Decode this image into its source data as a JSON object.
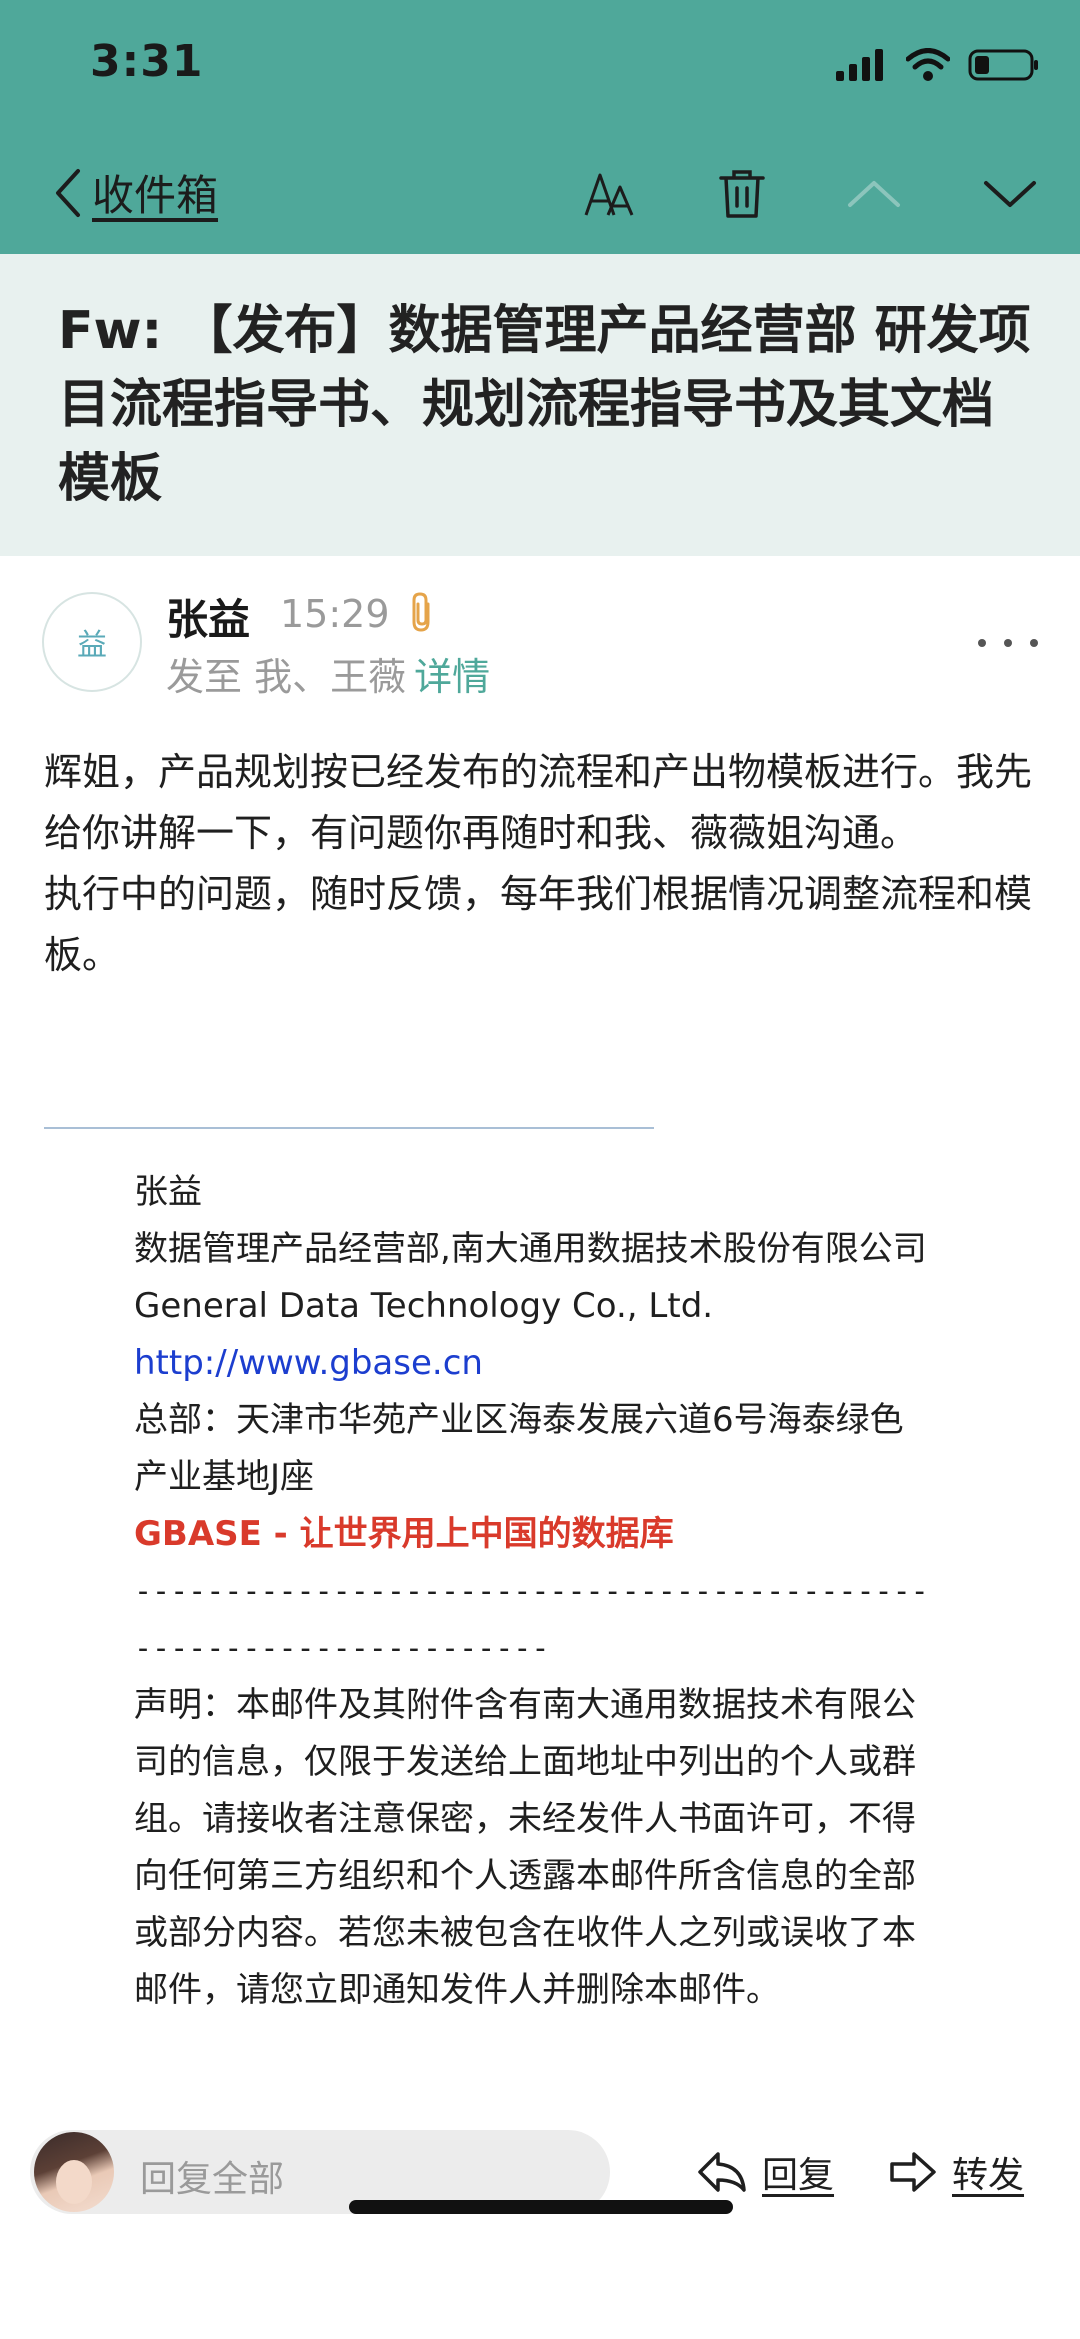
{
  "status_bar": {
    "time": "3:31"
  },
  "nav": {
    "back_label": "收件箱",
    "icons": [
      "font-size-icon",
      "trash-icon",
      "chevron-up-icon",
      "chevron-down-icon"
    ]
  },
  "subject": "Fw: 【发布】数据管理产品经营部 研发项目流程指导书、规划流程指导书及其文档模板",
  "sender": {
    "avatar_char": "益",
    "name": "张益",
    "time": "15:29",
    "to_prefix": "发至 我、王薇",
    "detail_label": "详情"
  },
  "body": {
    "line1": "辉姐，产品规划按已经发布的流程和产出物模板进行。我先给你讲解一下，有问题你再随时和我、薇薇姐沟通。",
    "line2": "执行中的问题，随时反馈，每年我们根据情况调整流程和模板。"
  },
  "signature": {
    "name": "张益",
    "org": "数据管理产品经营部,南大通用数据技术股份有限公司",
    "company_en": "General Data Technology Co., Ltd.",
    "website": "http://www.gbase.cn",
    "address": "总部：天津市华苑产业区海泰发展六道6号海泰绿色产业基地J座",
    "slogan": "GBASE - 让世界用上中国的数据库",
    "dashes": "-------------------------------------------------------------------",
    "disclaimer": "声明：本邮件及其附件含有南大通用数据技术有限公司的信息，仅限于发送给上面地址中列出的个人或群组。请接收者注意保密，未经发件人书面许可，不得向任何第三方组织和个人透露本邮件所含信息的全部或部分内容。若您未被包含在收件人之列或误收了本邮件，请您立即通知发件人并删除本邮件。"
  },
  "bottom": {
    "reply_all_placeholder": "回复全部",
    "reply_label": "回复",
    "forward_label": "转发"
  },
  "colors": {
    "accent": "#4fa89a",
    "link": "#1c3ecf",
    "slogan": "#d93a2b"
  }
}
